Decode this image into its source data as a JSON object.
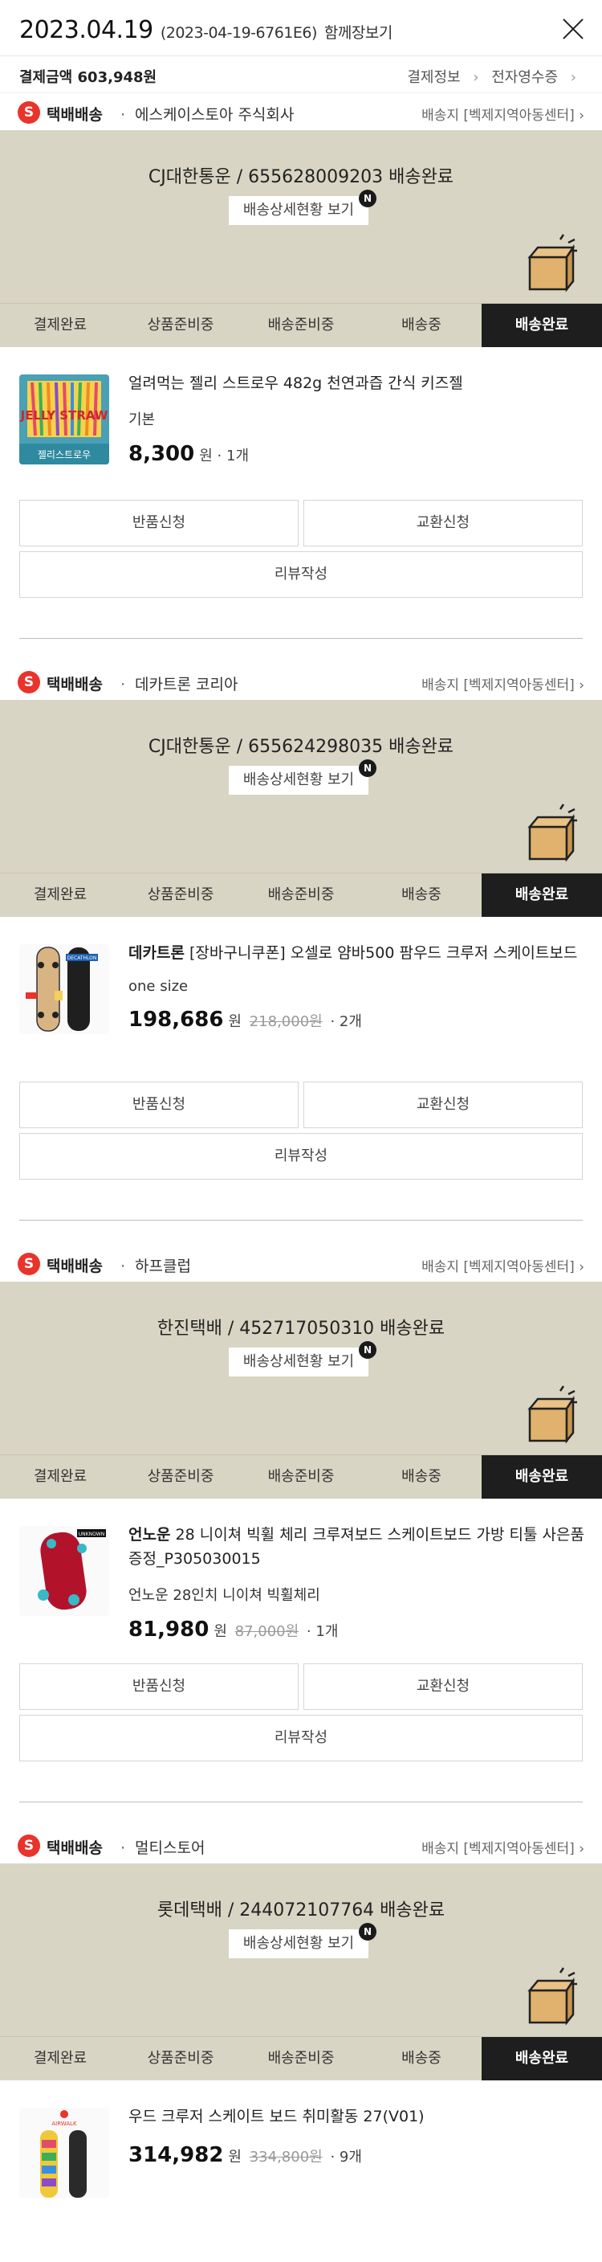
{
  "header": {
    "date": "2023.04.19",
    "order_code": "(2023-04-19-6761E6)",
    "together_label": "함께장보기",
    "close_label": "close"
  },
  "payment": {
    "label": "결제금액",
    "amount": "603,948원",
    "info_link": "결제정보",
    "receipt_link": "전자영수증"
  },
  "steps": [
    "결제완료",
    "상품준비중",
    "배송준비중",
    "배송중",
    "배송완료"
  ],
  "shipments": [
    {
      "method": "택배배송",
      "seller": "에스케이스토아 주식회사",
      "dest": "배송지 [벡제지역아동센터]",
      "tracking": "CJ대한통운 / 655628009203 배송완료",
      "detail_button": "배송상세현황 보기",
      "new_badge": "N",
      "product": {
        "brand": "",
        "title": "얼려먹는 젤리 스트로우 482g 천연과즙 간식 키즈젤",
        "option": "기본",
        "price": "8,300",
        "won": "원",
        "original": "",
        "qty": "· 1개"
      },
      "buttons": {
        "return": "반품신청",
        "exchange": "교환신청",
        "review": "리뷰작성"
      }
    },
    {
      "method": "택배배송",
      "seller": "데카트론 코리아",
      "dest": "배송지 [벡제지역아동센터]",
      "tracking": "CJ대한통운 / 655624298035 배송완료",
      "detail_button": "배송상세현황 보기",
      "new_badge": "N",
      "product": {
        "brand": "데카트론",
        "title": "[장바구니쿠폰] 오셀로 얌바500 팜우드 크루저 스케이트보드",
        "option": "one size",
        "price": "198,686",
        "won": "원",
        "original": "218,000원",
        "qty": "· 2개"
      },
      "buttons": {
        "return": "반품신청",
        "exchange": "교환신청",
        "review": "리뷰작성"
      }
    },
    {
      "method": "택배배송",
      "seller": "하프클럽",
      "dest": "배송지 [벡제지역아동센터]",
      "tracking": "한진택배 / 452717050310 배송완료",
      "detail_button": "배송상세현황 보기",
      "new_badge": "N",
      "product": {
        "brand": "언노운",
        "title": "28 니이쳐 빅휠 체리 크루져보드 스케이트보드 가방 티툴 사은품증정_P305030015",
        "option": "언노운 28인치 니이쳐 빅휠체리",
        "price": "81,980",
        "won": "원",
        "original": "87,000원",
        "qty": "· 1개"
      },
      "buttons": {
        "return": "반품신청",
        "exchange": "교환신청",
        "review": "리뷰작성"
      }
    },
    {
      "method": "택배배송",
      "seller": "멀티스토어",
      "dest": "배송지 [벡제지역아동센터]",
      "tracking": "롯데택배 / 244072107764 배송완료",
      "detail_button": "배송상세현황 보기",
      "new_badge": "N",
      "product": {
        "brand": "",
        "title": "우드 크루저 스케이트 보드 취미활동 27(V01)",
        "option": "",
        "price": "314,982",
        "won": "원",
        "original": "334,800원",
        "qty": "· 9개"
      },
      "buttons": {
        "return": "반품신청",
        "exchange": "교환신청",
        "review": "리뷰작성"
      }
    }
  ],
  "thumb_labels": {
    "jelly": "JELLY STRAW",
    "jelly_sub": "젤리스트로우",
    "decathlon": "DECATHLON",
    "unknown": "UNKNOWN",
    "airwalk": "AIRWALK"
  },
  "colors": {
    "tracking_bg": "#d9d5c4",
    "active_step_bg": "#1e1e1e",
    "badge_red": "#e9332b"
  }
}
